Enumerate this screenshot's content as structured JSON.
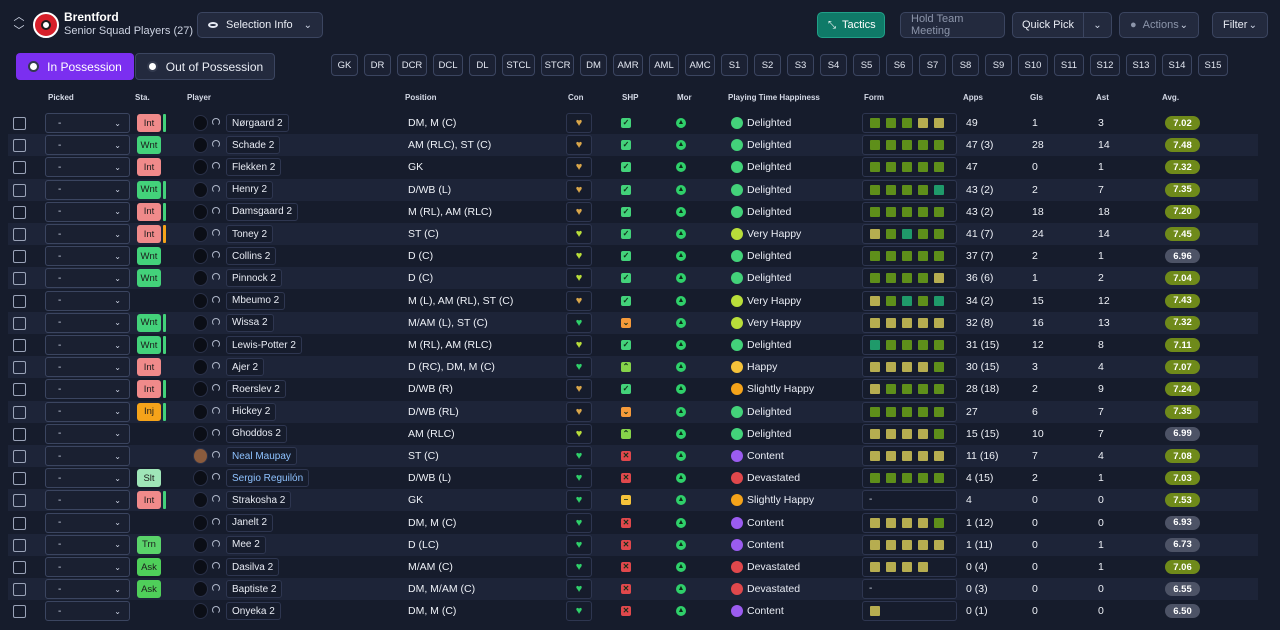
{
  "header": {
    "club_name": "Brentford",
    "squad_name": "Senior Squad Players (27)"
  },
  "toolbar": {
    "selection_info": "Selection Info",
    "tactics": "Tactics",
    "hold_team_meeting": "Hold Team Meeting",
    "quick_pick": "Quick Pick",
    "actions": "Actions",
    "filter": "Filter"
  },
  "tabs": {
    "in_possession": "In Possession",
    "out_of_possession": "Out of Possession"
  },
  "positions": [
    "GK",
    "DR",
    "DCR",
    "DCL",
    "DL",
    "STCL",
    "STCR",
    "DM",
    "AMR",
    "AML",
    "AMC",
    "S1",
    "S2",
    "S3",
    "S4",
    "S5",
    "S6",
    "S7",
    "S8",
    "S9",
    "S10",
    "S11",
    "S12",
    "S13",
    "S14",
    "S15"
  ],
  "columns": {
    "picked": "Picked",
    "sta": "Sta.",
    "player": "Player",
    "position": "Position",
    "con": "Con",
    "shp": "SHP",
    "mor": "Mor",
    "pth": "Playing Time Happiness",
    "form": "Form",
    "apps": "Apps",
    "gls": "Gls",
    "ast": "Ast",
    "avg": "Avg."
  },
  "colors": {
    "accent": "#7b2ff0",
    "tactics": "#0f7a68",
    "int": "#f08a8a",
    "wnt": "#43d27a",
    "inj": "#f5a31a",
    "slt": "#9fe6b8",
    "trn": "#5ad36a",
    "ask": "#4fcf5a"
  },
  "players": [
    {
      "picked": "-",
      "status": "Int",
      "status_bar": "#43d27a",
      "name": "Nørgaard 2",
      "position": "DM, M (C)",
      "con": "amber",
      "shp": "ok",
      "happiness": "Delighted",
      "form": [
        "g",
        "g",
        "g",
        "y",
        "y"
      ],
      "apps": "49",
      "gls": "1",
      "ast": "3",
      "avg": "7.02"
    },
    {
      "picked": "-",
      "status": "Wnt",
      "status_bar": "",
      "name": "Schade 2",
      "position": "AM (RLC), ST (C)",
      "con": "amber",
      "shp": "ok",
      "happiness": "Delighted",
      "form": [
        "g",
        "g",
        "g",
        "g",
        "g"
      ],
      "apps": "47 (3)",
      "gls": "28",
      "ast": "14",
      "avg": "7.48"
    },
    {
      "picked": "-",
      "status": "Int",
      "status_bar": "",
      "name": "Flekken 2",
      "position": "GK",
      "con": "amber",
      "shp": "ok",
      "happiness": "Delighted",
      "form": [
        "g",
        "g",
        "g",
        "g",
        "g"
      ],
      "apps": "47",
      "gls": "0",
      "ast": "1",
      "avg": "7.32"
    },
    {
      "picked": "-",
      "status": "Wnt",
      "status_bar": "#43d27a",
      "name": "Henry 2",
      "position": "D/WB (L)",
      "con": "amber",
      "shp": "ok",
      "happiness": "Delighted",
      "form": [
        "g",
        "g",
        "g",
        "g",
        "t"
      ],
      "apps": "43 (2)",
      "gls": "2",
      "ast": "7",
      "avg": "7.35"
    },
    {
      "picked": "-",
      "status": "Int",
      "status_bar": "#43d27a",
      "name": "Damsgaard 2",
      "position": "M (RL), AM (RLC)",
      "con": "amber",
      "shp": "ok",
      "happiness": "Delighted",
      "form": [
        "g",
        "g",
        "g",
        "g",
        "g"
      ],
      "apps": "43 (2)",
      "gls": "18",
      "ast": "18",
      "avg": "7.20"
    },
    {
      "picked": "-",
      "status": "Int",
      "status_bar": "#f5a31a",
      "name": "Toney 2",
      "position": "ST (C)",
      "con": "lime",
      "shp": "ok",
      "happiness": "Very Happy",
      "form": [
        "y",
        "g",
        "t",
        "g",
        "g"
      ],
      "apps": "41 (7)",
      "gls": "24",
      "ast": "14",
      "avg": "7.45"
    },
    {
      "picked": "-",
      "status": "Wnt",
      "status_bar": "",
      "name": "Collins 2",
      "position": "D (C)",
      "con": "lime",
      "shp": "ok",
      "happiness": "Delighted",
      "form": [
        "g",
        "g",
        "g",
        "g",
        "g"
      ],
      "apps": "37 (7)",
      "gls": "2",
      "ast": "1",
      "avg": "6.96"
    },
    {
      "picked": "-",
      "status": "Wnt",
      "status_bar": "",
      "name": "Pinnock 2",
      "position": "D (C)",
      "con": "lime",
      "shp": "ok",
      "happiness": "Delighted",
      "form": [
        "g",
        "g",
        "g",
        "g",
        "y"
      ],
      "apps": "36 (6)",
      "gls": "1",
      "ast": "2",
      "avg": "7.04"
    },
    {
      "picked": "-",
      "status": "",
      "status_bar": "",
      "name": "Mbeumo 2",
      "position": "M (L), AM (RL), ST (C)",
      "con": "amber",
      "shp": "ok",
      "happiness": "Very Happy",
      "form": [
        "y",
        "g",
        "t",
        "g",
        "t"
      ],
      "apps": "34 (2)",
      "gls": "15",
      "ast": "12",
      "avg": "7.43"
    },
    {
      "picked": "-",
      "status": "Wnt",
      "status_bar": "#43d27a",
      "name": "Wissa 2",
      "position": "M/AM (L), ST (C)",
      "con": "green",
      "shp": "warn",
      "happiness": "Very Happy",
      "form": [
        "y",
        "y",
        "y",
        "y",
        "y"
      ],
      "apps": "32 (8)",
      "gls": "16",
      "ast": "13",
      "avg": "7.32"
    },
    {
      "picked": "-",
      "status": "Wnt",
      "status_bar": "#43d27a",
      "name": "Lewis-Potter 2",
      "position": "M (RL), AM (RLC)",
      "con": "lime",
      "shp": "ok",
      "happiness": "Delighted",
      "form": [
        "t",
        "g",
        "g",
        "g",
        "g"
      ],
      "apps": "31 (15)",
      "gls": "12",
      "ast": "8",
      "avg": "7.11"
    },
    {
      "picked": "-",
      "status": "Int",
      "status_bar": "",
      "name": "Ajer 2",
      "position": "D (RC), DM, M (C)",
      "con": "green",
      "shp": "up",
      "happiness": "Happy",
      "form": [
        "y",
        "y",
        "y",
        "y",
        "g"
      ],
      "apps": "30 (15)",
      "gls": "3",
      "ast": "4",
      "avg": "7.07"
    },
    {
      "picked": "-",
      "status": "Int",
      "status_bar": "#43d27a",
      "name": "Roerslev 2",
      "position": "D/WB (R)",
      "con": "amber",
      "shp": "ok",
      "happiness": "Slightly Happy",
      "form": [
        "y",
        "g",
        "g",
        "g",
        "g"
      ],
      "apps": "28 (18)",
      "gls": "2",
      "ast": "9",
      "avg": "7.24"
    },
    {
      "picked": "-",
      "status": "Inj",
      "status_bar": "#43d27a",
      "name": "Hickey 2",
      "position": "D/WB (RL)",
      "con": "amber",
      "shp": "warn",
      "happiness": "Delighted",
      "form": [
        "g",
        "g",
        "g",
        "g",
        "g"
      ],
      "apps": "27",
      "gls": "6",
      "ast": "7",
      "avg": "7.35"
    },
    {
      "picked": "-",
      "status": "",
      "status_bar": "",
      "name": "Ghoddos 2",
      "position": "AM (RLC)",
      "con": "lime",
      "shp": "up",
      "happiness": "Delighted",
      "form": [
        "y",
        "y",
        "y",
        "y",
        "g"
      ],
      "apps": "15 (15)",
      "gls": "10",
      "ast": "7",
      "avg": "6.99"
    },
    {
      "picked": "-",
      "status": "",
      "status_bar": "",
      "name": "Neal Maupay",
      "position": "ST (C)",
      "con": "green",
      "shp": "bad",
      "happiness": "Content",
      "form": [
        "y",
        "y",
        "y",
        "y",
        "y"
      ],
      "apps": "11 (16)",
      "gls": "7",
      "ast": "4",
      "avg": "7.08"
    },
    {
      "picked": "-",
      "status": "Slt",
      "status_bar": "",
      "name": "Sergio Reguilón",
      "position": "D/WB (L)",
      "con": "green",
      "shp": "bad",
      "happiness": "Devastated",
      "form": [
        "g",
        "g",
        "g",
        "g",
        "g"
      ],
      "apps": "4 (15)",
      "gls": "2",
      "ast": "1",
      "avg": "7.03"
    },
    {
      "picked": "-",
      "status": "Int",
      "status_bar": "#43d27a",
      "name": "Strakosha 2",
      "position": "GK",
      "con": "green",
      "shp": "mid",
      "happiness": "Slightly Happy",
      "form": [],
      "apps": "4",
      "gls": "0",
      "ast": "0",
      "avg": "7.53"
    },
    {
      "picked": "-",
      "status": "",
      "status_bar": "",
      "name": "Janelt 2",
      "position": "DM, M (C)",
      "con": "green",
      "shp": "bad",
      "happiness": "Content",
      "form": [
        "y",
        "y",
        "y",
        "y",
        "g"
      ],
      "apps": "1 (12)",
      "gls": "0",
      "ast": "0",
      "avg": "6.93"
    },
    {
      "picked": "-",
      "status": "Trn",
      "status_bar": "",
      "name": "Mee 2",
      "position": "D (LC)",
      "con": "green",
      "shp": "bad",
      "happiness": "Content",
      "form": [
        "y",
        "y",
        "y",
        "y",
        "y"
      ],
      "apps": "1 (11)",
      "gls": "0",
      "ast": "1",
      "avg": "6.73"
    },
    {
      "picked": "-",
      "status": "Ask",
      "status_bar": "",
      "name": "Dasilva 2",
      "position": "M/AM (C)",
      "con": "green",
      "shp": "bad",
      "happiness": "Devastated",
      "form": [
        "y",
        "y",
        "y",
        "y"
      ],
      "apps": "0 (4)",
      "gls": "0",
      "ast": "1",
      "avg": "7.06"
    },
    {
      "picked": "-",
      "status": "Ask",
      "status_bar": "",
      "name": "Baptiste 2",
      "position": "DM, M/AM (C)",
      "con": "green",
      "shp": "bad",
      "happiness": "Devastated",
      "form": [],
      "apps": "0 (3)",
      "gls": "0",
      "ast": "0",
      "avg": "6.55"
    },
    {
      "picked": "-",
      "status": "",
      "status_bar": "",
      "name": "Onyeka 2",
      "position": "DM, M (C)",
      "con": "green",
      "shp": "bad",
      "happiness": "Content",
      "form": [
        "y"
      ],
      "apps": "0 (1)",
      "gls": "0",
      "ast": "0",
      "avg": "6.50"
    }
  ]
}
